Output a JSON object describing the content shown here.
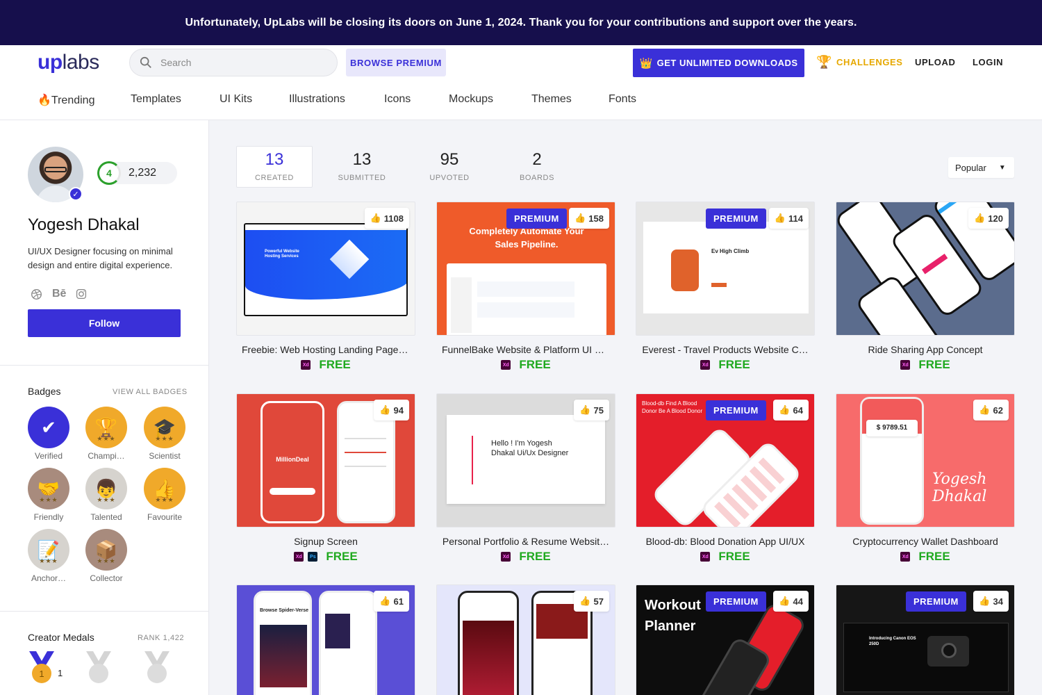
{
  "banner": {
    "text": "Unfortunately, UpLabs will be closing its doors on June 1, 2024. Thank you for your contributions and support over the years."
  },
  "header": {
    "logo_up": "up",
    "logo_labs": "labs",
    "search_placeholder": "Search",
    "browse_premium": "BROWSE PREMIUM",
    "unlimited": "GET UNLIMITED DOWNLOADS",
    "challenges": "CHALLENGES",
    "upload": "UPLOAD",
    "login": "LOGIN"
  },
  "categories": [
    "🔥Trending",
    "Templates",
    "UI Kits",
    "Illustrations",
    "Icons",
    "Mockups",
    "Themes",
    "Fonts"
  ],
  "profile": {
    "level": "4",
    "points": "2,232",
    "name": "Yogesh Dhakal",
    "bio": "UI/UX Designer focusing on minimal design and entire digital experience.",
    "social_behance": "Bē",
    "follow": "Follow"
  },
  "badges": {
    "title": "Badges",
    "view_all": "VIEW ALL BADGES",
    "items": [
      {
        "label": "Verified",
        "icon": "check-icon"
      },
      {
        "label": "Champi…",
        "icon": "trophy-icon"
      },
      {
        "label": "Scientist",
        "icon": "graduation-cap-icon"
      },
      {
        "label": "Friendly",
        "icon": "handshake-icon"
      },
      {
        "label": "Talented",
        "icon": "person-icon"
      },
      {
        "label": "Favourite",
        "icon": "thumbs-up-icon"
      },
      {
        "label": "Anchor…",
        "icon": "notepad-icon"
      },
      {
        "label": "Collector",
        "icon": "box-icon"
      }
    ]
  },
  "medals": {
    "title": "Creator Medals",
    "rank": "RANK 1,422",
    "gold_count": "1",
    "gold_number": "1"
  },
  "stats": [
    {
      "n": "13",
      "l": "CREATED"
    },
    {
      "n": "13",
      "l": "SUBMITTED"
    },
    {
      "n": "95",
      "l": "UPVOTED"
    },
    {
      "n": "2",
      "l": "BOARDS"
    }
  ],
  "sort": {
    "value": "Popular"
  },
  "cards": [
    {
      "title": "Freebie: Web Hosting Landing Page …",
      "likes": "1108",
      "premium": false,
      "apps": [
        "Xd"
      ],
      "price": "FREE",
      "thumb_text": "Powerful Website Hosting Services"
    },
    {
      "title": "FunnelBake Website & Platform UI D…",
      "likes": "158",
      "premium": true,
      "apps": [
        "Xd"
      ],
      "price": "FREE",
      "thumb_text": "Completely Automate Your Sales Pipeline."
    },
    {
      "title": "Everest - Travel Products Website C…",
      "likes": "114",
      "premium": true,
      "apps": [
        "Xd"
      ],
      "price": "FREE",
      "thumb_text": "Ev High Climb"
    },
    {
      "title": "Ride Sharing App Concept",
      "likes": "120",
      "premium": false,
      "apps": [
        "Xd"
      ],
      "price": "FREE",
      "thumb_text": ""
    },
    {
      "title": "Signup Screen",
      "likes": "94",
      "premium": false,
      "apps": [
        "Xd",
        "Ps"
      ],
      "price": "FREE",
      "thumb_text": "MillionDeal"
    },
    {
      "title": "Personal Portfolio & Resume Websit…",
      "likes": "75",
      "premium": false,
      "apps": [
        "Xd"
      ],
      "price": "FREE",
      "thumb_text": "Hello ! I'm Yogesh Dhakal Ui/Ux Designer"
    },
    {
      "title": "Blood-db: Blood Donation App UI/UX",
      "likes": "64",
      "premium": true,
      "apps": [
        "Xd"
      ],
      "price": "FREE",
      "thumb_text": "Blood-db Find A Blood Donor Be A Blood Donor"
    },
    {
      "title": "Cryptocurrency Wallet Dashboard",
      "likes": "62",
      "premium": false,
      "apps": [
        "Xd"
      ],
      "price": "FREE",
      "thumb_text": "$ 9789.51"
    },
    {
      "title": "",
      "likes": "61",
      "premium": false,
      "apps": [],
      "price": "",
      "thumb_text": "Browse Spider-Verse"
    },
    {
      "title": "",
      "likes": "57",
      "premium": false,
      "apps": [],
      "price": "",
      "thumb_text": ""
    },
    {
      "title": "",
      "likes": "44",
      "premium": true,
      "apps": [],
      "price": "",
      "thumb_text": "Workout Planner"
    },
    {
      "title": "",
      "likes": "34",
      "premium": true,
      "apps": [],
      "price": "",
      "thumb_text": "Introducing Canon EOS 250D"
    }
  ],
  "premium_label": "PREMIUM",
  "colors": {
    "brand": "#3a30d8",
    "banner": "#160f4c",
    "free": "#1fa91f",
    "challenges": "#e6a800"
  }
}
